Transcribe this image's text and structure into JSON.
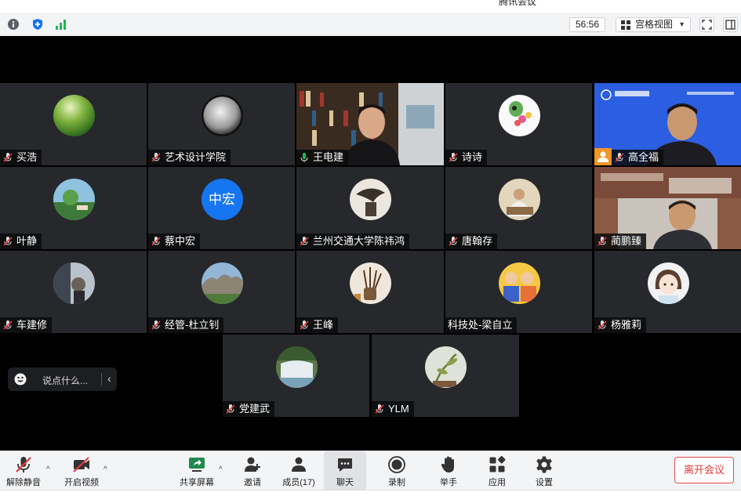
{
  "window": {
    "title": "腾讯会议"
  },
  "topbar": {
    "timer": "56:56",
    "view_label": "宫格视图",
    "icons": [
      "info-icon",
      "shield-icon",
      "signal-icon",
      "grid-icon",
      "fullscreen-icon",
      "sidebar-icon"
    ]
  },
  "participants": [
    {
      "name": "买浩",
      "mic": "muted"
    },
    {
      "name": "艺术设计学院",
      "mic": "muted"
    },
    {
      "name": "王电建",
      "mic": "active",
      "video": true
    },
    {
      "name": "诗诗",
      "mic": "muted"
    },
    {
      "name": "高全福",
      "mic": "muted",
      "video": true,
      "host": true
    },
    {
      "name": "叶静",
      "mic": "muted"
    },
    {
      "name": "蔡中宏",
      "mic": "muted",
      "avatar_text": "中宏"
    },
    {
      "name": "兰州交通大学陈祎鸿",
      "mic": "muted"
    },
    {
      "name": "唐翰存",
      "mic": "muted"
    },
    {
      "name": "蔺鹏臻",
      "mic": "muted",
      "video": true
    },
    {
      "name": "车建修",
      "mic": "muted"
    },
    {
      "name": "经管-杜立钊",
      "mic": "muted"
    },
    {
      "name": "王峰",
      "mic": "muted"
    },
    {
      "name": "科技处-梁自立",
      "mic": "none"
    },
    {
      "name": "杨雅莉",
      "mic": "muted"
    },
    {
      "name": "党建武",
      "mic": "muted"
    },
    {
      "name": "YLM",
      "mic": "muted"
    }
  ],
  "chat": {
    "placeholder": "说点什么..."
  },
  "toolbar": {
    "unmute": "解除静音",
    "start_video": "开启视频",
    "share_screen": "共享屏幕",
    "invite": "邀请",
    "members": "成员(17)",
    "chat": "聊天",
    "record": "录制",
    "raise_hand": "举手",
    "apps": "应用",
    "settings": "设置",
    "leave": "离开会议"
  },
  "colors": {
    "tile_bg": "#27282c",
    "active_border": "#1db954",
    "leave_red": "#e23a3a",
    "avatar_blue": "#1675f0",
    "host_orange": "#f0962a"
  }
}
